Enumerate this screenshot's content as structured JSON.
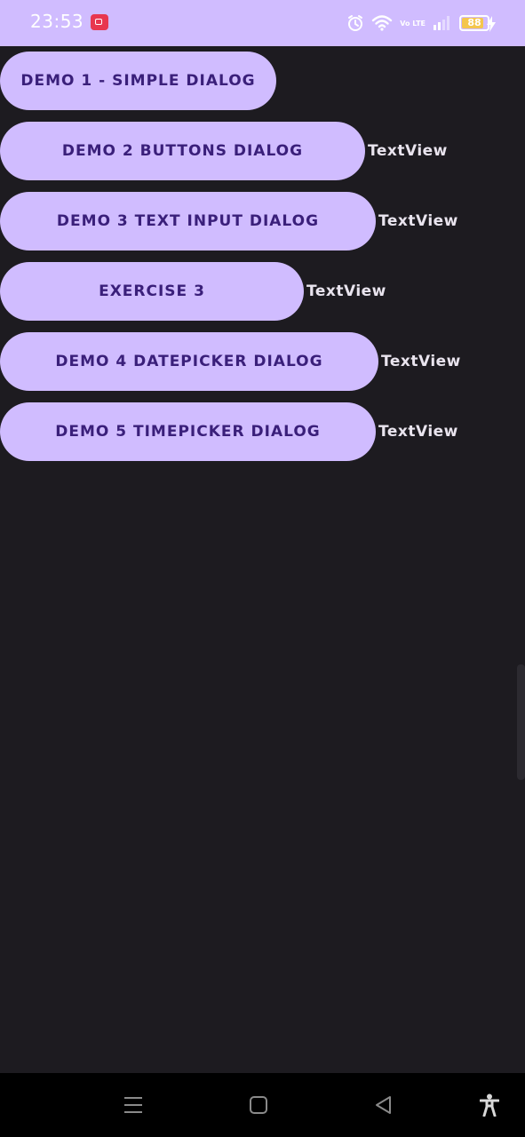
{
  "status_bar": {
    "time": "23:53",
    "volte_label": "Vo LTE",
    "battery_level": "88",
    "battery_fraction": 0.88
  },
  "buttons": [
    {
      "label": "DEMO 1 - SIMPLE DIALOG",
      "textview": ""
    },
    {
      "label": "DEMO 2 BUTTONS DIALOG",
      "textview": "TextView"
    },
    {
      "label": "DEMO 3 TEXT INPUT DIALOG",
      "textview": "TextView"
    },
    {
      "label": "EXERCISE 3",
      "textview": "TextView"
    },
    {
      "label": "DEMO 4 DATEPICKER DIALOG",
      "textview": "TextView"
    },
    {
      "label": "DEMO 5 TIMEPICKER DIALOG",
      "textview": "TextView"
    }
  ],
  "icons": {
    "recording": "screen-record-icon",
    "alarm": "alarm-icon",
    "wifi": "wifi-icon",
    "signal": "signal-icon",
    "battery": "battery-icon",
    "charging": "charging-bolt-icon",
    "nav_menu": "menu-icon",
    "nav_home": "home-icon",
    "nav_back": "back-icon",
    "nav_accessibility": "accessibility-icon"
  },
  "colors": {
    "status_bar": "#d0bcff",
    "background": "#1d1b20",
    "button": "#d0bcff",
    "button_text": "#3a1f7a",
    "textview": "#e9e4ee",
    "nav_bar": "#000000"
  }
}
